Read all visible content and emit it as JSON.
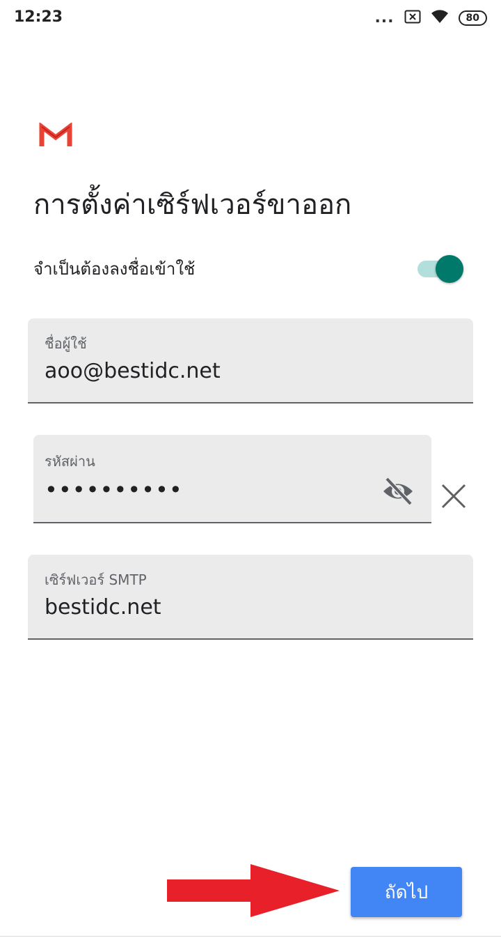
{
  "status_bar": {
    "time": "12:23",
    "more_dots": "...",
    "battery": "80"
  },
  "header": {
    "logo_icon": "gmail-icon",
    "title": "การตั้งค่าเซิร์ฟเวอร์ขาออก"
  },
  "auth": {
    "label": "จำเป็นต้องลงชื่อเข้าใช้",
    "enabled": true,
    "accent_color": "#00796b"
  },
  "username": {
    "label": "ชื่อผู้ใช้",
    "value": "aoo@bestidc.net"
  },
  "password": {
    "label": "รหัสผ่าน",
    "value": "••••••••••",
    "visibility_icon": "visibility-off-icon",
    "clear_icon": "close-icon"
  },
  "smtp_server": {
    "label": "เซิร์ฟเวอร์ SMTP",
    "value": "bestidc.net"
  },
  "footer": {
    "next_label": "ถัดไป",
    "button_color": "#4285f4",
    "arrow_color": "#e8202a"
  }
}
